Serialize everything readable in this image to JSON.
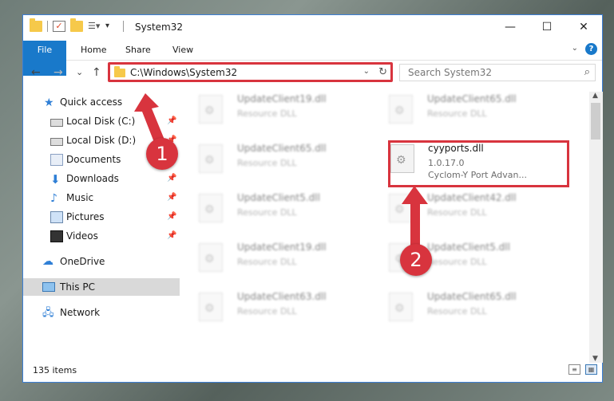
{
  "window": {
    "title": "System32",
    "controls": {
      "minimize": "—",
      "maximize": "☐",
      "close": "✕"
    }
  },
  "ribbon": {
    "tabs": [
      "File",
      "Home",
      "Share",
      "View"
    ],
    "collapse_icon": "chevron-down-icon",
    "help_label": "?"
  },
  "navigation": {
    "back": "←",
    "forward": "→",
    "recent": "⌄",
    "up": "↑",
    "address_path": "C:\\Windows\\System32",
    "search_placeholder": "Search System32"
  },
  "sidebar": {
    "items": [
      {
        "label": "Quick access",
        "icon": "star-icon",
        "pinned": false
      },
      {
        "label": "Local Disk (C:)",
        "icon": "drive-icon",
        "pinned": true
      },
      {
        "label": "Local Disk (D:)",
        "icon": "drive-icon",
        "pinned": true
      },
      {
        "label": "Documents",
        "icon": "document-icon",
        "pinned": true
      },
      {
        "label": "Downloads",
        "icon": "download-icon",
        "pinned": true
      },
      {
        "label": "Music",
        "icon": "music-icon",
        "pinned": true
      },
      {
        "label": "Pictures",
        "icon": "pictures-icon",
        "pinned": true
      },
      {
        "label": "Videos",
        "icon": "videos-icon",
        "pinned": true
      },
      {
        "label": "OneDrive",
        "icon": "cloud-icon",
        "pinned": false
      },
      {
        "label": "This PC",
        "icon": "computer-icon",
        "pinned": false,
        "selected": true
      },
      {
        "label": "Network",
        "icon": "network-icon",
        "pinned": false
      }
    ]
  },
  "files": [
    {
      "name": "UpdateClient19.dll",
      "desc": "Resource DLL",
      "blurred": true
    },
    {
      "name": "UpdateClient65.dll",
      "desc": "Resource DLL",
      "blurred": true
    },
    {
      "name": "UpdateClient65.dll",
      "desc": "Resource DLL",
      "blurred": true
    },
    {
      "name": "cyyports.dll",
      "desc": "1.0.17.0",
      "desc2": "Cyclom-Y Port Advan...",
      "blurred": false
    },
    {
      "name": "UpdateClient5.dll",
      "desc": "Resource DLL",
      "blurred": true
    },
    {
      "name": "UpdateClient42.dll",
      "desc": "Resource DLL",
      "blurred": true
    },
    {
      "name": "UpdateClient19.dll",
      "desc": "Resource DLL",
      "blurred": true
    },
    {
      "name": "UpdateClient5.dll",
      "desc": "Resource DLL",
      "blurred": true
    },
    {
      "name": "UpdateClient63.dll",
      "desc": "Resource DLL",
      "blurred": true
    },
    {
      "name": "UpdateClient65.dll",
      "desc": "Resource DLL",
      "blurred": true
    }
  ],
  "status": {
    "item_count": "135 items"
  },
  "annotations": {
    "step1": "1",
    "step2": "2",
    "color": "#d8343e"
  }
}
